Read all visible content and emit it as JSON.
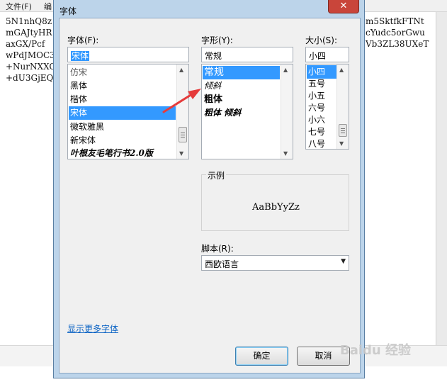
{
  "notepad": {
    "menu": [
      "文件(F)",
      "编"
    ],
    "left_lines": [
      "5N1nhQ8z",
      "mGAJtyHR",
      "axGX/Pcf",
      "wPdJMOC3",
      "+NurNXXO",
      "+dU3GjEQ"
    ],
    "right_lines": [
      "m5SktfkFTNt",
      "cYudc5orGwu",
      "Vb3ZL38UXeT"
    ]
  },
  "dialog": {
    "title": "字体",
    "close_symbol": "✕",
    "font": {
      "label": "字体(F):",
      "value": "宋体",
      "items": [
        "仿宋",
        "黑体",
        "楷体",
        "宋体",
        "微软雅黑",
        "新宋体",
        "叶根友毛笔行书2.0版"
      ],
      "selected_index": 3
    },
    "style": {
      "label": "字形(Y):",
      "value": "常规",
      "items": [
        "常规",
        "倾斜",
        "粗体",
        "粗体 倾斜"
      ],
      "selected_index": 0
    },
    "size": {
      "label": "大小(S):",
      "value": "小四",
      "items": [
        "小四",
        "五号",
        "小五",
        "六号",
        "小六",
        "七号",
        "八号"
      ],
      "selected_index": 0
    },
    "sample": {
      "label": "示例",
      "text": "AaBbYyZz"
    },
    "script": {
      "label": "脚本(R):",
      "value": "西欧语言"
    },
    "more_fonts_link": "显示更多字体",
    "ok_label": "确定",
    "cancel_label": "取消"
  },
  "watermark": "Baidu 经验",
  "colors": {
    "selection": "#3399ff",
    "title_bar": "#bcd4ea",
    "close_button": "#c9453a",
    "annotation_arrow": "#e53b3b",
    "link": "#0b63c4"
  }
}
